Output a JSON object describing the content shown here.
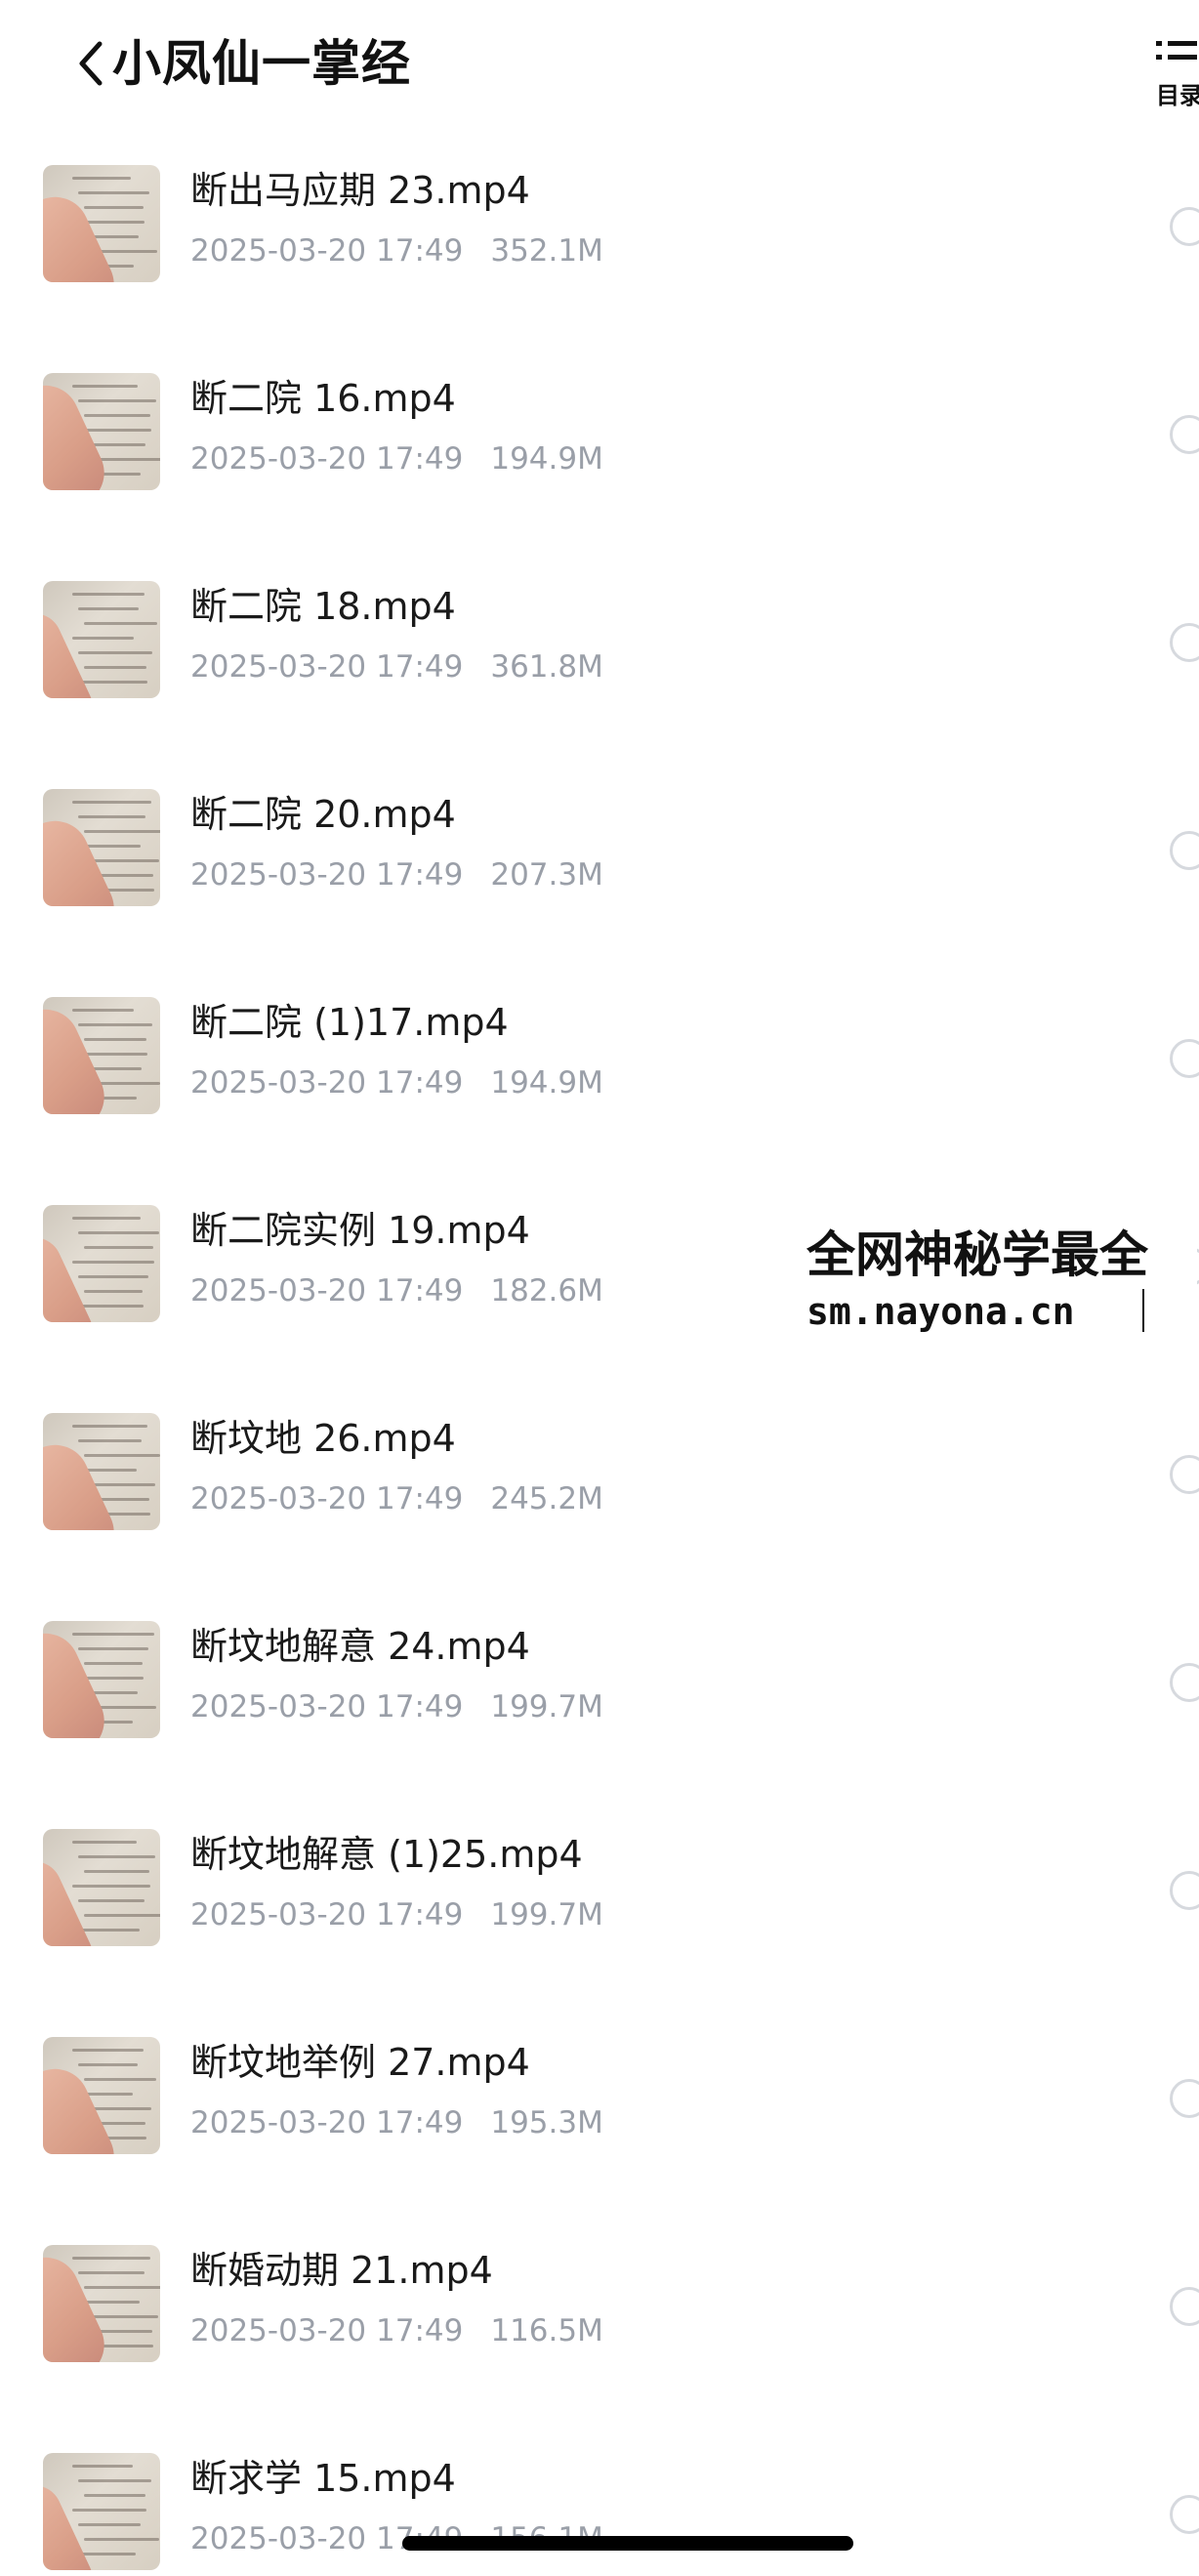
{
  "header": {
    "title": "小凤仙一掌经",
    "menu_label": "目录"
  },
  "files": [
    {
      "name": "断出马应期 23.mp4",
      "date": "2025-03-20 17:49",
      "size": "352.1M"
    },
    {
      "name": "断二院 16.mp4",
      "date": "2025-03-20 17:49",
      "size": "194.9M"
    },
    {
      "name": "断二院 18.mp4",
      "date": "2025-03-20 17:49",
      "size": "361.8M"
    },
    {
      "name": "断二院 20.mp4",
      "date": "2025-03-20 17:49",
      "size": "207.3M"
    },
    {
      "name": "断二院 (1)17.mp4",
      "date": "2025-03-20 17:49",
      "size": "194.9M"
    },
    {
      "name": "断二院实例 19.mp4",
      "date": "2025-03-20 17:49",
      "size": "182.6M"
    },
    {
      "name": "断坟地 26.mp4",
      "date": "2025-03-20 17:49",
      "size": "245.2M"
    },
    {
      "name": "断坟地解意 24.mp4",
      "date": "2025-03-20 17:49",
      "size": "199.7M"
    },
    {
      "name": "断坟地解意 (1)25.mp4",
      "date": "2025-03-20 17:49",
      "size": "199.7M"
    },
    {
      "name": "断坟地举例 27.mp4",
      "date": "2025-03-20 17:49",
      "size": "195.3M"
    },
    {
      "name": "断婚动期 21.mp4",
      "date": "2025-03-20 17:49",
      "size": "116.5M"
    },
    {
      "name": "断求学 15.mp4",
      "date": "2025-03-20 17:49",
      "size": "156.1M"
    }
  ],
  "watermark": {
    "title": "全网神秘学最全",
    "url": "sm.nayona.cn"
  }
}
